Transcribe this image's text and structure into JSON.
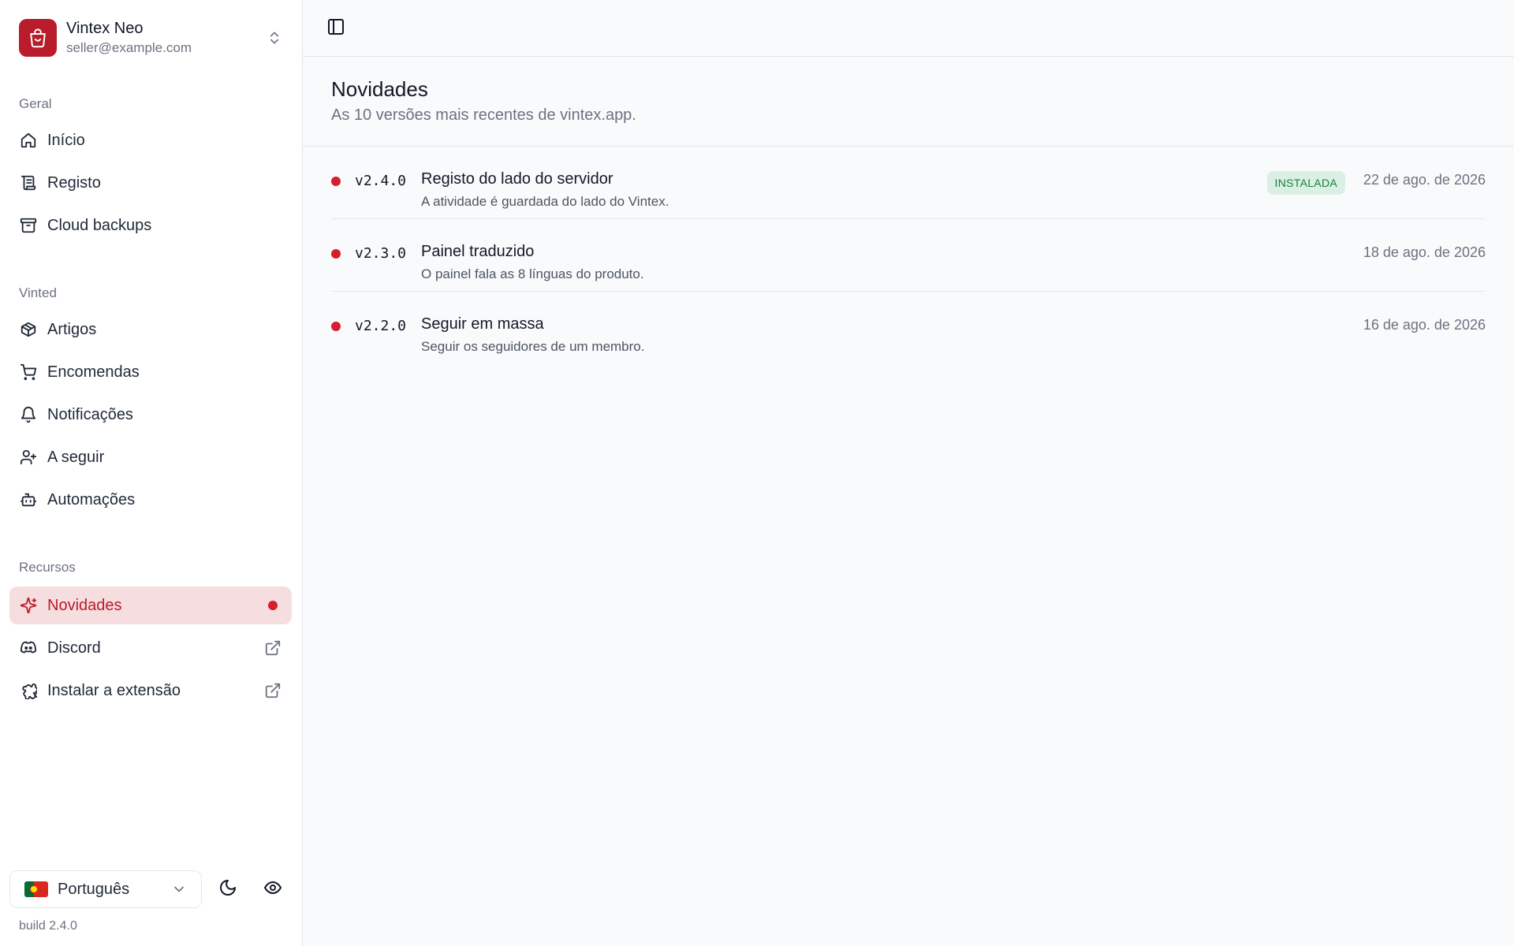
{
  "account": {
    "name": "Vintex Neo",
    "email": "seller@example.com"
  },
  "sidebar": {
    "sections": [
      {
        "title": "Geral",
        "items": [
          {
            "label": "Início",
            "icon": "home-icon"
          },
          {
            "label": "Registo",
            "icon": "scroll-icon"
          },
          {
            "label": "Cloud backups",
            "icon": "archive-icon"
          }
        ]
      },
      {
        "title": "Vinted",
        "items": [
          {
            "label": "Artigos",
            "icon": "package-icon"
          },
          {
            "label": "Encomendas",
            "icon": "cart-icon"
          },
          {
            "label": "Notificações",
            "icon": "bell-icon"
          },
          {
            "label": "A seguir",
            "icon": "user-plus-icon"
          },
          {
            "label": "Automações",
            "icon": "bot-icon"
          }
        ]
      },
      {
        "title": "Recursos",
        "items": [
          {
            "label": "Novidades",
            "icon": "sparkles-icon",
            "active": true,
            "unread": true
          },
          {
            "label": "Discord",
            "icon": "discord-icon",
            "external": true
          },
          {
            "label": "Instalar a extensão",
            "icon": "puzzle-icon",
            "external": true
          }
        ]
      }
    ],
    "language": "Português",
    "build": "build 2.4.0"
  },
  "main": {
    "title": "Novidades",
    "subtitle": "As 10 versões mais recentes de vintex.app.",
    "releases": [
      {
        "version": "v2.4.0",
        "title": "Registo do lado do servidor",
        "description": "A atividade é guardada do lado do Vintex.",
        "badge": "INSTALADA",
        "date": "22 de ago. de 2026"
      },
      {
        "version": "v2.3.0",
        "title": "Painel traduzido",
        "description": "O painel fala as 8 línguas do produto.",
        "date": "18 de ago. de 2026"
      },
      {
        "version": "v2.2.0",
        "title": "Seguir em massa",
        "description": "Seguir os seguidores de um membro.",
        "date": "16 de ago. de 2026"
      }
    ]
  },
  "colors": {
    "accent": "#b91c2b",
    "active_bg": "#f5dde0",
    "unread_dot": "#d61f2c",
    "badge_bg": "#dcefe4",
    "badge_text": "#15803d"
  }
}
